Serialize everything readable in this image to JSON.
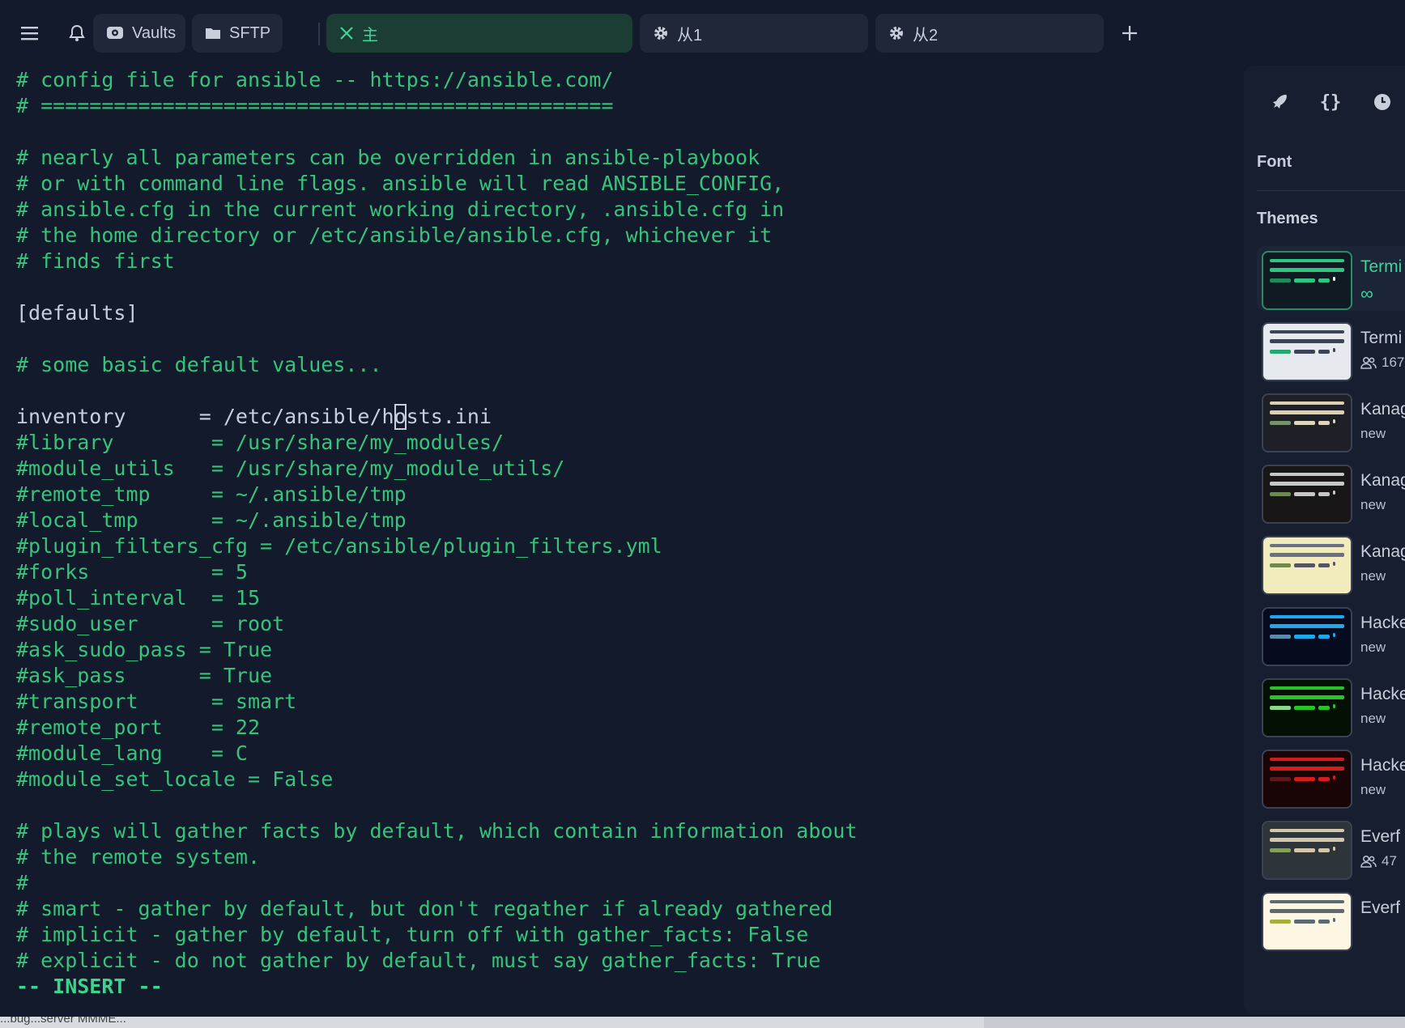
{
  "tabbar": {
    "tabs": [
      {
        "label": "Vaults",
        "icon": "vault-icon"
      },
      {
        "label": "SFTP",
        "icon": "folder-icon"
      },
      {
        "label": "主",
        "icon": "close-icon",
        "active": true
      },
      {
        "label": "从1",
        "icon": "gear-icon"
      },
      {
        "label": "从2",
        "icon": "gear-icon"
      }
    ]
  },
  "terminal": {
    "lines": [
      "# config file for ansible -- https://ansible.com/",
      "# ===============================================",
      "",
      "# nearly all parameters can be overridden in ansible-playbook",
      "# or with command line flags. ansible will read ANSIBLE_CONFIG,",
      "# ansible.cfg in the current working directory, .ansible.cfg in",
      "# the home directory or /etc/ansible/ansible.cfg, whichever it",
      "# finds first",
      "",
      "[defaults]",
      "",
      "# some basic default values...",
      "",
      "inventory      = /etc/ansible/hosts.ini",
      "#library        = /usr/share/my_modules/",
      "#module_utils   = /usr/share/my_module_utils/",
      "#remote_tmp     = ~/.ansible/tmp",
      "#local_tmp      = ~/.ansible/tmp",
      "#plugin_filters_cfg = /etc/ansible/plugin_filters.yml",
      "#forks          = 5",
      "#poll_interval  = 15",
      "#sudo_user      = root",
      "#ask_sudo_pass = True",
      "#ask_pass      = True",
      "#transport      = smart",
      "#remote_port    = 22",
      "#module_lang    = C",
      "#module_set_locale = False",
      "",
      "# plays will gather facts by default, which contain information about",
      "# the remote system.",
      "#",
      "# smart - gather by default, but don't regather if already gathered",
      "# implicit - gather by default, turn off with gather_facts: False",
      "# explicit - do not gather by default, must say gather_facts: True"
    ],
    "inventory_prefix": "inventory      = /etc/ansible/h",
    "cursor_char": "o",
    "inventory_suffix": "sts.ini",
    "mode": "-- INSERT --"
  },
  "panel": {
    "font_heading": "Font",
    "themes_heading": "Themes",
    "themes": [
      {
        "name": "Termi",
        "meta": "∞",
        "selected": true,
        "bg": "#0f1a22",
        "bar": "#2fc77f",
        "c1": "#1f8a5a",
        "c2": "#2fc77f",
        "c3": "#ffffff"
      },
      {
        "name": "Termi",
        "meta": "167",
        "users": true,
        "bg": "#e6e9ee",
        "bar": "#3b4456",
        "c1": "#24a86b",
        "c2": "#3b4456",
        "c3": "#3b4456"
      },
      {
        "name": "Kanag",
        "meta": "new",
        "bg": "#1f1f28",
        "bar": "#dcd1ae",
        "c1": "#76946a",
        "c2": "#dcd7ba",
        "c3": "#dcd7ba"
      },
      {
        "name": "Kanag",
        "meta": "new",
        "bg": "#181616",
        "bar": "#c5c9c5",
        "c1": "#6a8a55",
        "c2": "#c5c9c5",
        "c3": "#c5c9c5"
      },
      {
        "name": "Kanag",
        "meta": "new",
        "bg": "#f2ecbc",
        "bar": "#6c6f86",
        "c1": "#6f894e",
        "c2": "#545464",
        "c3": "#545464"
      },
      {
        "name": "Hacke",
        "meta": "new",
        "bg": "#060b1e",
        "bar": "#1ea8f0",
        "c1": "#5a8ab0",
        "c2": "#1ea8f0",
        "c3": "#1ea8f0"
      },
      {
        "name": "Hacke",
        "meta": "new",
        "bg": "#041004",
        "bar": "#26c426",
        "c1": "#8ad88a",
        "c2": "#26c426",
        "c3": "#26c426"
      },
      {
        "name": "Hacke",
        "meta": "new",
        "bg": "#1a0506",
        "bar": "#d41c1c",
        "c1": "#5a1a1a",
        "c2": "#d41c1c",
        "c3": "#d41c1c"
      },
      {
        "name": "Everf",
        "meta": "47",
        "users": true,
        "bg": "#2d353b",
        "bar": "#d3c6aa",
        "c1": "#83a060",
        "c2": "#d3c6aa",
        "c3": "#d3c6aa"
      },
      {
        "name": "Everf",
        "meta": "",
        "bg": "#fdf6e3",
        "bar": "#5c6a72",
        "c1": "#a7b03a",
        "c2": "#5c6a72",
        "c3": "#5c6a72"
      }
    ]
  },
  "background_window": {
    "text": "...bug...server MMME..."
  }
}
